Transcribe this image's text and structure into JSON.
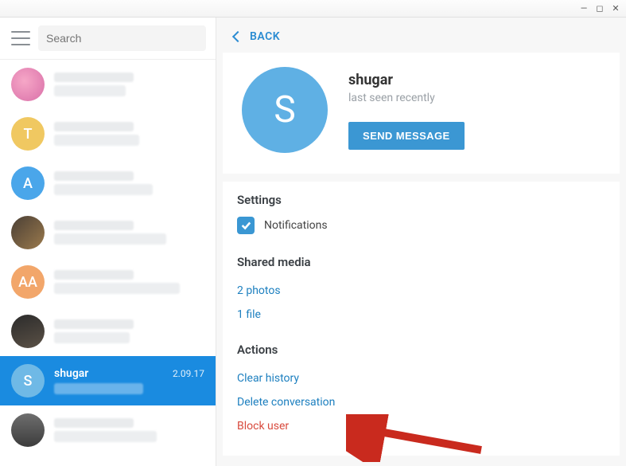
{
  "window": {
    "search_placeholder": "Search",
    "back_label": "BACK"
  },
  "chats": [
    {
      "avatar_class": "av-pink",
      "initial": "",
      "blurred": true
    },
    {
      "avatar_class": "av-yellow",
      "initial": "T",
      "blurred": true
    },
    {
      "avatar_class": "av-blue",
      "initial": "A",
      "blurred": true
    },
    {
      "avatar_class": "av-photo1",
      "initial": "",
      "blurred": true
    },
    {
      "avatar_class": "av-orange",
      "initial": "AA",
      "blurred": true
    },
    {
      "avatar_class": "av-photo2",
      "initial": "",
      "blurred": true
    },
    {
      "avatar_class": "av-lightblue",
      "initial": "S",
      "name": "shugar",
      "date": "2.09.17",
      "selected": true
    },
    {
      "avatar_class": "av-photo3",
      "initial": "",
      "blurred": true
    }
  ],
  "profile": {
    "initial": "S",
    "name": "shugar",
    "status": "last seen recently",
    "send_label": "SEND MESSAGE"
  },
  "settings": {
    "title": "Settings",
    "notifications_label": "Notifications",
    "notifications_checked": true
  },
  "shared": {
    "title": "Shared media",
    "photos": "2 photos",
    "files": "1 file"
  },
  "actions": {
    "title": "Actions",
    "clear": "Clear history",
    "delete": "Delete conversation",
    "block": "Block user"
  }
}
